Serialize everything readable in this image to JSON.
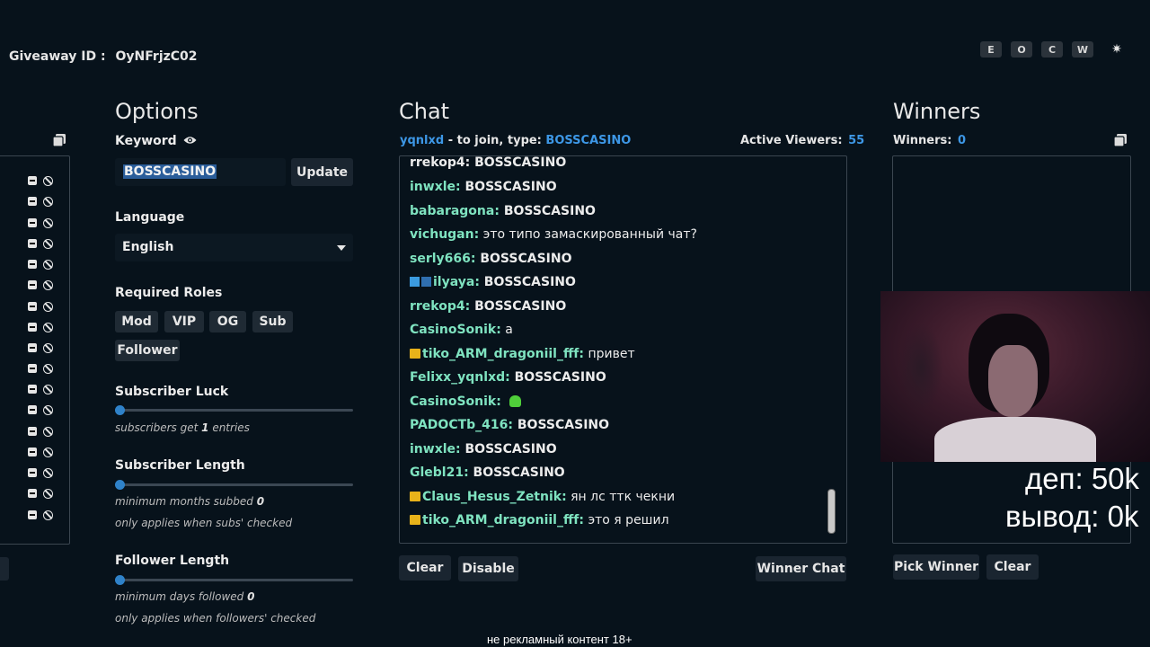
{
  "header": {
    "giveaway_label": "Giveaway ID :",
    "giveaway_id": "OyNFrjzC02"
  },
  "controls": [
    "E",
    "O",
    "C",
    "W"
  ],
  "options": {
    "title": "Options",
    "keyword_label": "Keyword",
    "keyword_value": "BOSSCASINO",
    "update_label": "Update",
    "language_label": "Language",
    "language_value": "English",
    "roles_label": "Required Roles",
    "roles": [
      "Mod",
      "VIP",
      "OG",
      "Sub",
      "Follower"
    ],
    "sub_luck_label": "Subscriber Luck",
    "sub_luck_hint_pre": "subscribers get",
    "sub_luck_value": "1",
    "sub_luck_hint_post": "entries",
    "sub_length_label": "Subscriber Length",
    "sub_length_hint_pre": "minimum months subbed",
    "sub_length_value": "0",
    "sub_length_note": "only applies when subs' checked",
    "follower_length_label": "Follower Length",
    "follower_length_hint_pre": "minimum days followed",
    "follower_length_value": "0",
    "follower_length_note": "only applies when followers' checked"
  },
  "chat": {
    "title": "Chat",
    "channel": "yqnlxd",
    "join_text": "- to join, type:",
    "join_keyword": "BOSSCASINO",
    "viewers_label": "Active Viewers:",
    "viewers_count": "55",
    "partial_top": "rrekop4: BOSSCASINO",
    "messages": [
      {
        "user": "inwxle:",
        "text": "BOSSCASINO"
      },
      {
        "user": "babaragona:",
        "text": "BOSSCASINO"
      },
      {
        "user": "vichugan:",
        "text": "это типо замаскированный чат?"
      },
      {
        "user": "serly666:",
        "text": "BOSSCASINO"
      },
      {
        "user": "ilyaya:",
        "text": "BOSSCASINO"
      },
      {
        "user": "rrekop4:",
        "text": "BOSSCASINO"
      },
      {
        "user": "CasinoSonik:",
        "text": "а"
      },
      {
        "user": "tiko_ARM_dragoniil_fff:",
        "text": "привет"
      },
      {
        "user": "Felixx_yqnlxd:",
        "text": "BOSSCASINO"
      },
      {
        "user": "CasinoSonik:",
        "text": ""
      },
      {
        "user": "PADOCTb_416:",
        "text": "BOSSCASINO"
      },
      {
        "user": "inwxle:",
        "text": "BOSSCASINO"
      },
      {
        "user": "Glebl21:",
        "text": "BOSSCASINO"
      },
      {
        "user": "Claus_Hesus_Zetnik:",
        "text": "ян лс ттк чекни"
      },
      {
        "user": "tiko_ARM_dragoniil_fff:",
        "text": "это я решил"
      }
    ],
    "clear_label": "Clear",
    "disable_label": "Disable",
    "winner_chat_label": "Winner Chat"
  },
  "winners": {
    "title": "Winners",
    "count_label": "Winners:",
    "count": "0",
    "pick_label": "Pick Winner",
    "clear_label": "Clear"
  },
  "overlay": {
    "line1": "деп: 50k",
    "line2": "вывод: 0k",
    "footer": "не рекламный контент 18+"
  },
  "colors": {
    "accent": "#3d97e6",
    "username": "#7fe3c0",
    "background": "#07121b"
  }
}
